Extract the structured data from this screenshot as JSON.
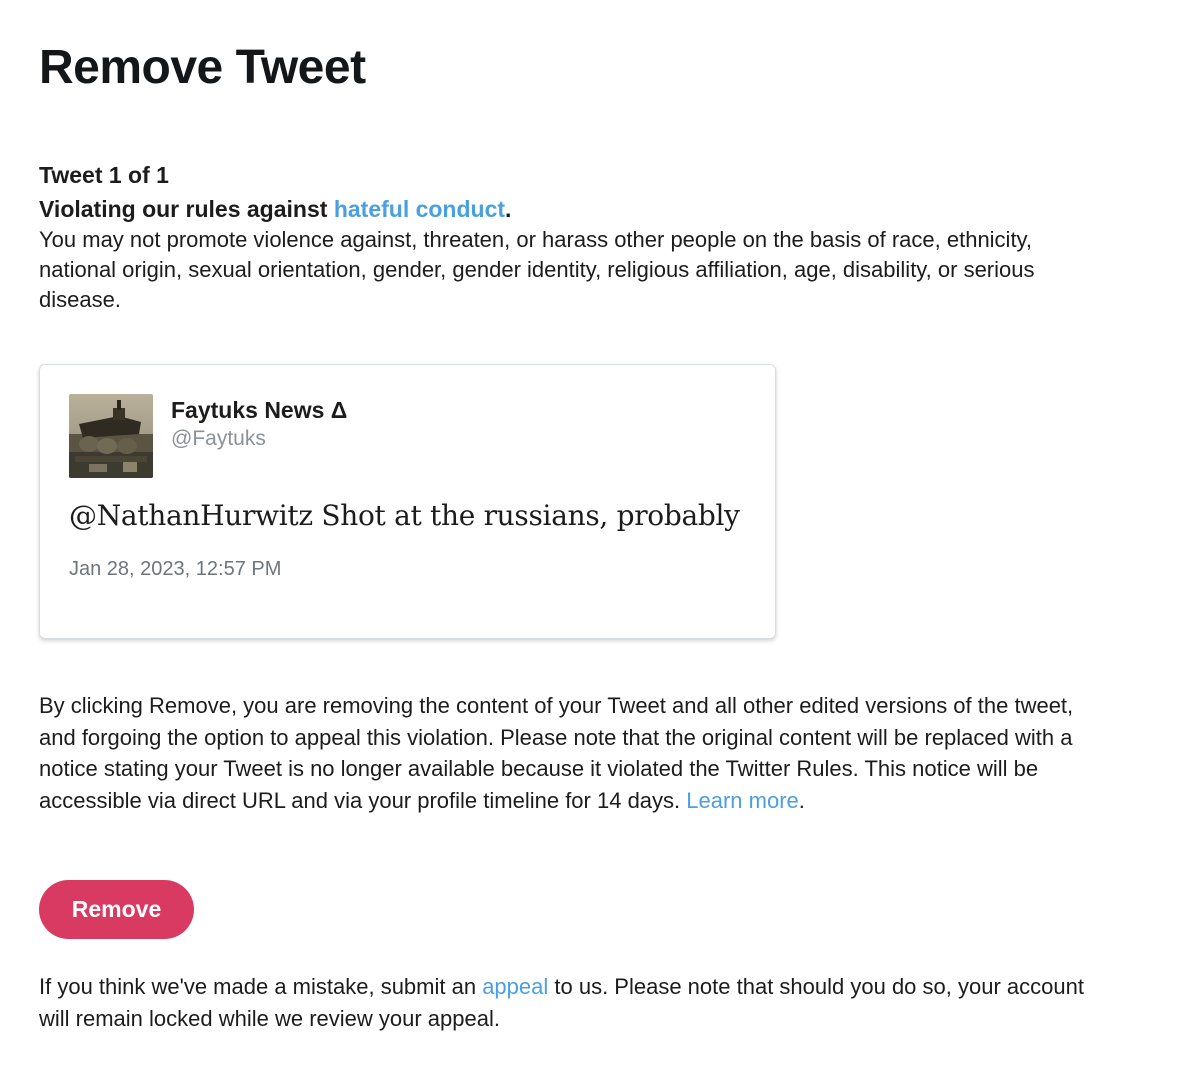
{
  "page": {
    "title": "Remove Tweet"
  },
  "violation": {
    "tweet_count": "Tweet 1 of 1",
    "heading_prefix": "Violating our rules against ",
    "heading_link": "hateful conduct",
    "heading_suffix": ".",
    "description": "You may not promote violence against, threaten, or harass other people on the basis of race, ethnicity, national origin, sexual orientation, gender, gender identity, religious affiliation, age, disability, or serious disease."
  },
  "tweet": {
    "author_name": "Faytuks News Δ",
    "author_handle": "@Faytuks",
    "text": "@NathanHurwitz Shot at the russians, probably",
    "timestamp": "Jan 28, 2023, 12:57 PM",
    "avatar_icon": "profile-photo"
  },
  "removal": {
    "info_text": "By clicking Remove, you are removing the content of your Tweet and all other edited versions of the tweet, and forgoing the option to appeal this violation. Please note that the original content will be replaced with a notice stating your Tweet is no longer available because it violated the Twitter Rules. This notice will be accessible via direct URL and via your profile timeline for 14 days. ",
    "learn_more_label": "Learn more",
    "info_suffix": ".",
    "button_label": "Remove",
    "button_color": "#d83a61"
  },
  "appeal": {
    "prefix": "If you think we've made a mistake, submit an ",
    "link_label": "appeal",
    "suffix": " to us. Please note that should you do so, your account will remain locked while we review your appeal."
  },
  "colors": {
    "link": "#4a9fe0",
    "text": "#1c1c1c",
    "muted": "#8a9299"
  }
}
